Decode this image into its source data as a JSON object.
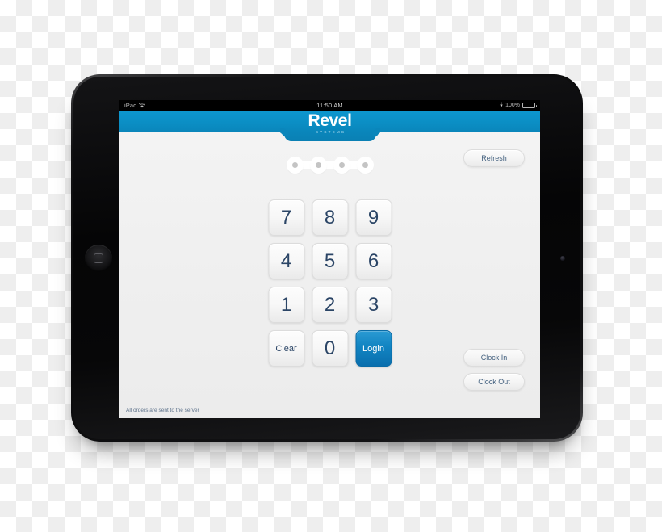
{
  "device": {
    "type": "tablet",
    "home_button": "home-button",
    "front_camera": "front-camera"
  },
  "status_bar": {
    "carrier": "iPad",
    "wifi_icon": "wifi-icon",
    "time": "11:50 AM",
    "battery_percent": "100%",
    "charging_icon": "lightning-bolt-icon"
  },
  "app": {
    "brand": {
      "name": "Revel",
      "subtitle": "SYSTEMS"
    },
    "pin": {
      "dot_count": 4,
      "entered": 0
    },
    "keypad": [
      {
        "label": "7",
        "name": "key-7",
        "style": "digit"
      },
      {
        "label": "8",
        "name": "key-8",
        "style": "digit"
      },
      {
        "label": "9",
        "name": "key-9",
        "style": "digit"
      },
      {
        "label": "4",
        "name": "key-4",
        "style": "digit"
      },
      {
        "label": "5",
        "name": "key-5",
        "style": "digit"
      },
      {
        "label": "6",
        "name": "key-6",
        "style": "digit"
      },
      {
        "label": "1",
        "name": "key-1",
        "style": "digit"
      },
      {
        "label": "2",
        "name": "key-2",
        "style": "digit"
      },
      {
        "label": "3",
        "name": "key-3",
        "style": "digit"
      },
      {
        "label": "Clear",
        "name": "key-clear",
        "style": "word"
      },
      {
        "label": "0",
        "name": "key-0",
        "style": "digit"
      },
      {
        "label": "Login",
        "name": "login-button",
        "style": "primary"
      }
    ],
    "side_buttons": {
      "refresh": "Refresh",
      "clock_in": "Clock In",
      "clock_out": "Clock Out"
    },
    "footer_note": "All orders are sent to the server"
  },
  "colors": {
    "header_blue": "#0b8ec4",
    "login_blue": "#1184c2",
    "key_text": "#2b4566",
    "pill_text": "#44617f",
    "screen_bg": "#f2f2f2",
    "footer_text": "#5c718a"
  }
}
